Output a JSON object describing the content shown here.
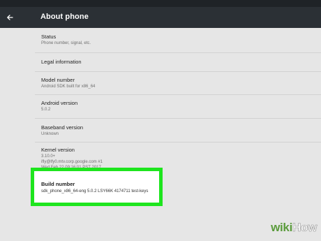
{
  "app": {
    "title": "About phone"
  },
  "settings": {
    "status": {
      "label": "Status",
      "sub": "Phone number, signal, etc."
    },
    "legal": {
      "label": "Legal information"
    },
    "model": {
      "label": "Model number",
      "sub": "Android SDK built for x86_64"
    },
    "android_version": {
      "label": "Android version",
      "sub": "5.0.2"
    },
    "baseband": {
      "label": "Baseband version",
      "sub": "Unknown"
    },
    "kernel": {
      "label": "Kernel version",
      "lines": [
        "3.10.0+",
        "ifly@lfy0.mtv.corp.google.com #1",
        "Wed Feb 22 09:16:01 PST 2017"
      ]
    },
    "build": {
      "label": "Build number",
      "sub": "sdk_phone_x86_64-eng 5.0.2 LSY66K 4174711 test-keys"
    }
  },
  "watermark": {
    "wiki": "wiki",
    "how": "How"
  },
  "icons": {
    "back": "back-arrow-icon"
  },
  "colors": {
    "appbar": "#2b3035",
    "highlight": "#1ee51e",
    "background": "#e6e6e6"
  }
}
